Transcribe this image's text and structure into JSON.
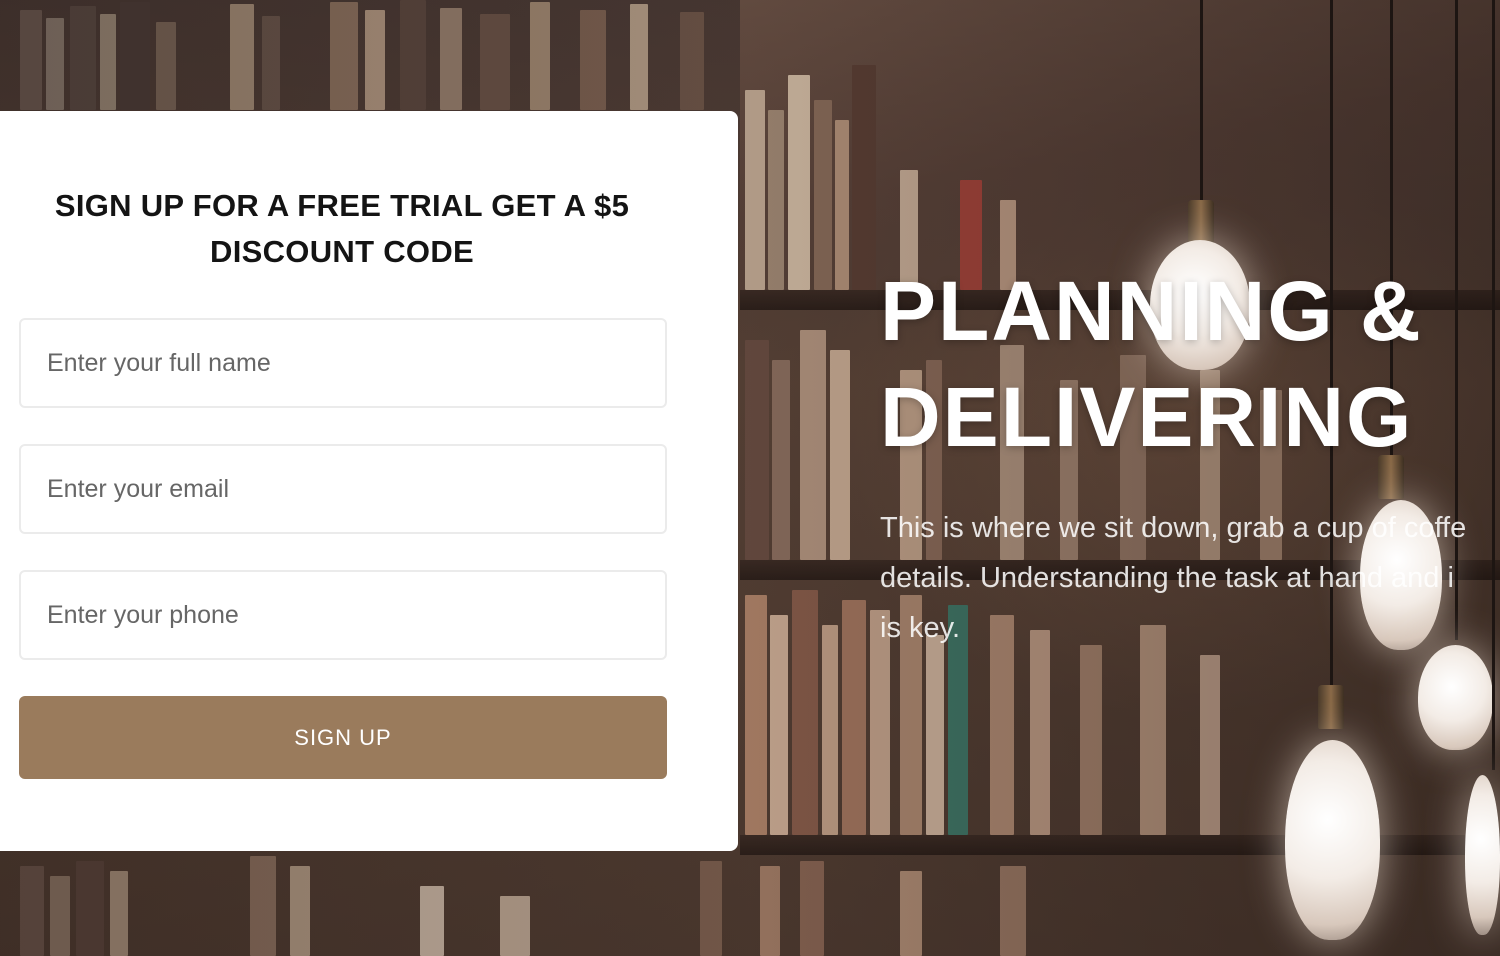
{
  "signup_card": {
    "title_line1": "SIGN UP FOR A FREE TRIAL GET A $5",
    "title_line2": "DISCOUNT CODE",
    "name_placeholder": "Enter your full name",
    "email_placeholder": "Enter your email",
    "phone_placeholder": "Enter your phone",
    "button_label": "SIGN UP"
  },
  "hero": {
    "title_line1": "PLANNING &",
    "title_line2": "DELIVERING",
    "text_line1": "This is where we sit down, grab a cup of coffe",
    "text_line2": "details. Understanding the task at hand and i",
    "text_line3": "is key."
  },
  "colors": {
    "button": "#9a7b5c",
    "card": "#ffffff",
    "title_text": "#141414"
  }
}
